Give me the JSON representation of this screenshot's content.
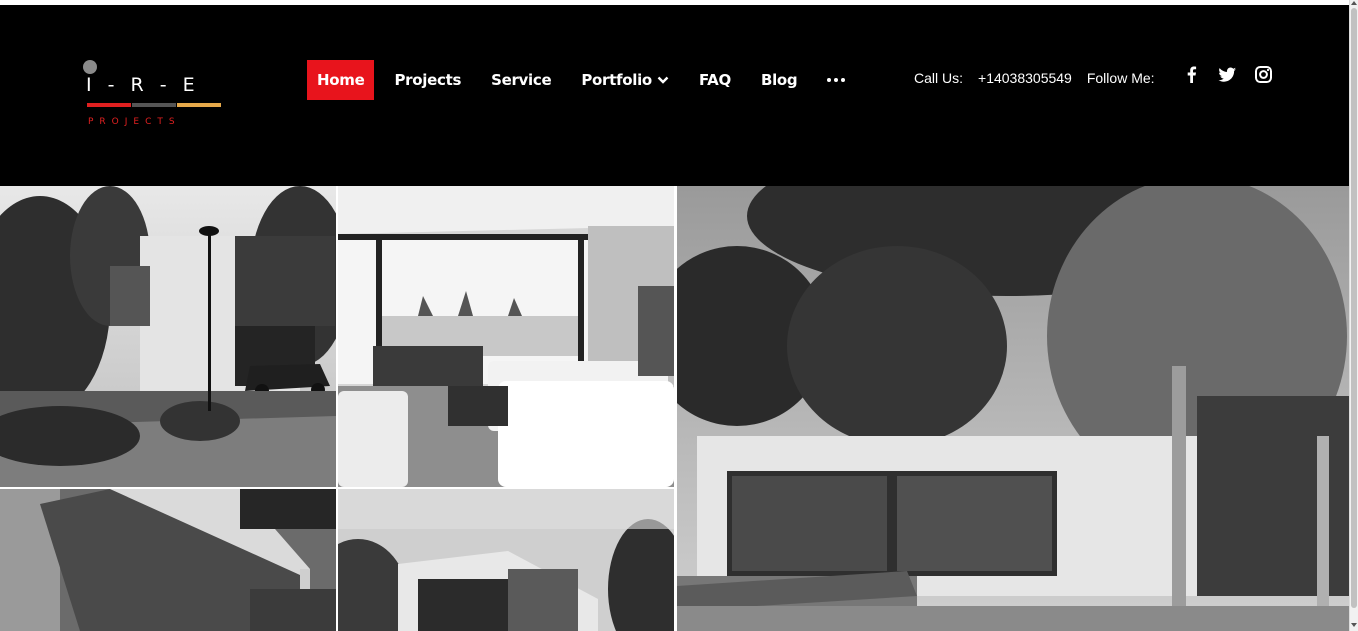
{
  "logo": {
    "letters": "I - R - E",
    "sub": "PROJECTS"
  },
  "nav": {
    "items": [
      {
        "label": "Home",
        "active": true
      },
      {
        "label": "Projects",
        "active": false
      },
      {
        "label": "Service",
        "active": false
      },
      {
        "label": "Portfolio",
        "active": false,
        "dropdown": true
      },
      {
        "label": "FAQ",
        "active": false
      },
      {
        "label": "Blog",
        "active": false
      }
    ],
    "more_icon": "ellipsis-icon"
  },
  "contact": {
    "call_label": "Call Us:",
    "phone": "+14038305549",
    "follow_label": "Follow Me:"
  },
  "social": [
    "facebook-icon",
    "twitter-icon",
    "instagram-icon"
  ],
  "gallery": [
    "modern-house-exterior",
    "living-room-interior",
    "tropical-house-exterior",
    "aerial-house-roof",
    "cube-house-exterior"
  ],
  "colors": {
    "header_bg": "#000000",
    "active_nav": "#e8141c",
    "logo_red": "#e02020",
    "logo_gray": "#555555",
    "logo_gold": "#e6a94a"
  }
}
